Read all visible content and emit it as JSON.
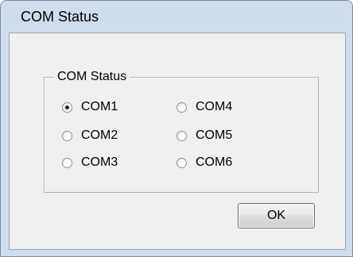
{
  "window": {
    "title": "COM Status"
  },
  "group": {
    "label": "COM Status"
  },
  "ports": [
    {
      "label": "COM1",
      "checked": true
    },
    {
      "label": "COM2",
      "checked": false
    },
    {
      "label": "COM3",
      "checked": false
    },
    {
      "label": "COM4",
      "checked": false
    },
    {
      "label": "COM5",
      "checked": false
    },
    {
      "label": "COM6",
      "checked": false
    }
  ],
  "buttons": {
    "ok_label": "OK"
  },
  "colors": {
    "frame": "#cfdceb",
    "client": "#f0f0f0"
  }
}
